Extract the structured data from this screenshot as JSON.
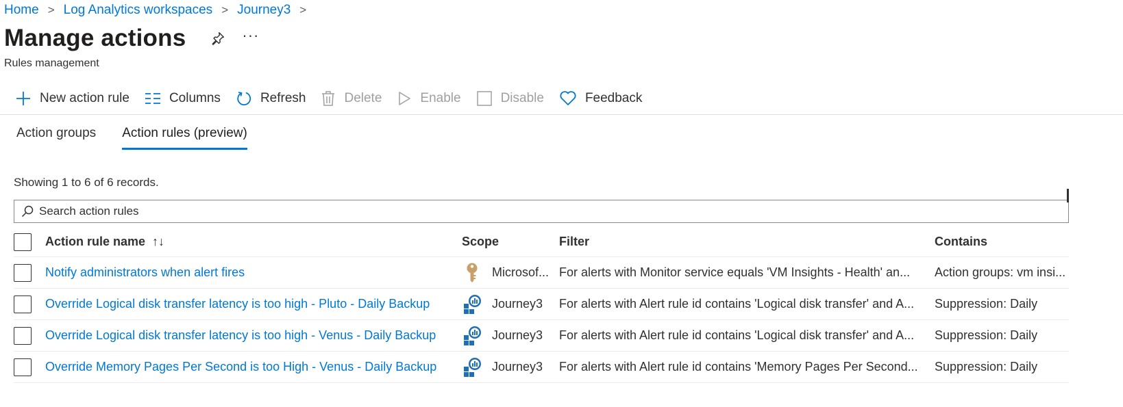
{
  "breadcrumb": [
    "Home",
    "Log Analytics workspaces",
    "Journey3"
  ],
  "page": {
    "title": "Manage actions",
    "subtitle": "Rules management"
  },
  "toolbar": {
    "new_rule": "New action rule",
    "columns": "Columns",
    "refresh": "Refresh",
    "delete": "Delete",
    "enable": "Enable",
    "disable": "Disable",
    "feedback": "Feedback"
  },
  "tabs": [
    "Action groups",
    "Action rules (preview)"
  ],
  "active_tab": "Action rules (preview)",
  "records_text": "Showing 1 to 6 of 6 records.",
  "search": {
    "placeholder": "Search action rules"
  },
  "table": {
    "columns": [
      "Action rule name",
      "Scope",
      "Filter",
      "Contains"
    ],
    "rows": [
      {
        "name": "Notify administrators when alert fires",
        "scope": "Microsof...",
        "scope_icon": "key-icon",
        "filter": "For alerts with Monitor service equals 'VM Insights - Health' an...",
        "contains": "Action groups: vm insi..."
      },
      {
        "name": "Override Logical disk transfer latency is too high - Pluto - Daily Backup",
        "scope": "Journey3",
        "scope_icon": "log-analytics-icon",
        "filter": "For alerts with Alert rule id contains 'Logical disk transfer' and A...",
        "contains": "Suppression: Daily"
      },
      {
        "name": "Override Logical disk transfer latency is too high - Venus - Daily Backup",
        "scope": "Journey3",
        "scope_icon": "log-analytics-icon",
        "filter": "For alerts with Alert rule id contains 'Logical disk transfer' and A...",
        "contains": "Suppression: Daily"
      },
      {
        "name": "Override Memory Pages Per Second is too High - Venus - Daily Backup",
        "scope": "Journey3",
        "scope_icon": "log-analytics-icon",
        "filter": "For alerts with Alert rule id contains 'Memory Pages Per Second...",
        "contains": "Suppression: Daily"
      }
    ]
  },
  "colors": {
    "accent": "#0078d4",
    "text": "#323130",
    "disabled": "#a19f9d",
    "key_gold": "#c8a16a",
    "analytics_blue": "#1f6fb8"
  }
}
